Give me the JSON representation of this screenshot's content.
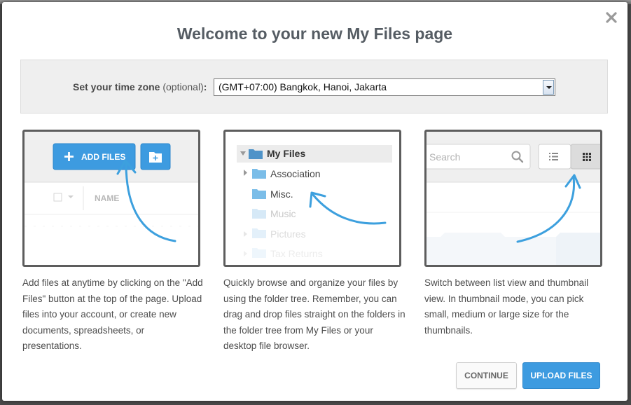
{
  "dialog": {
    "title": "Welcome to your new My Files page",
    "close_icon": "close-icon"
  },
  "timezone": {
    "label": "Set your time zone",
    "optional": "(optional)",
    "colon": ":",
    "selected": "(GMT+07:00) Bangkok, Hanoi, Jakarta"
  },
  "cards": {
    "add_files": {
      "button_label": "ADD FILES",
      "column_header": "NAME",
      "description": "Add files at anytime by clicking on the \"Add Files\" button at the top of the page. Upload files into your account, or create new documents, spreadsheets, or presentations."
    },
    "folder_tree": {
      "root": "My Files",
      "items": [
        "Association",
        "Misc.",
        "Music",
        "Pictures",
        "Tax Returns"
      ],
      "description": "Quickly browse and organize your files by using the folder tree. Remember, you can drag and drop files straight on the folders in the folder tree from My Files or your desktop file browser."
    },
    "views": {
      "search_placeholder": "Search",
      "description": "Switch between list view and thumbnail view. In thumbnail mode, you can pick small, medium or large size for the thumbnails."
    }
  },
  "actions": {
    "continue_label": "CONTINUE",
    "upload_label": "UPLOAD FILES"
  },
  "colors": {
    "accent": "#3d9be0",
    "arrow": "#3da0de",
    "folder": "#5aa9e0"
  }
}
